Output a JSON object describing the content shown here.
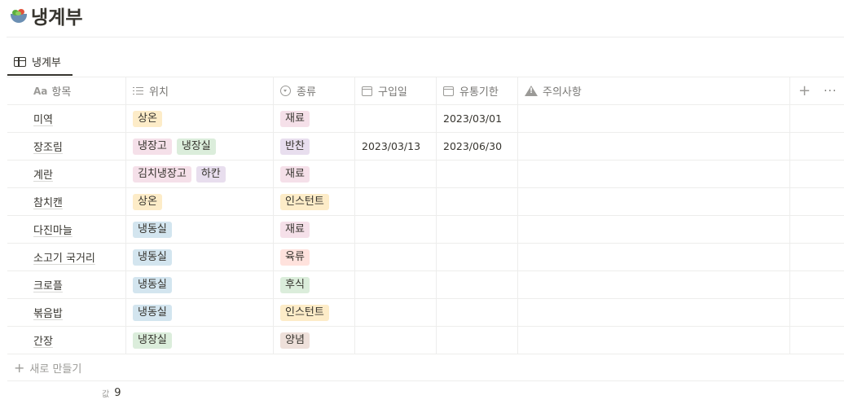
{
  "page": {
    "icon": "salad-bowl-icon",
    "title": "냉계부"
  },
  "view_tab": {
    "icon": "table-icon",
    "label": "냉계부"
  },
  "columns": [
    {
      "icon": "text-aa-icon",
      "icon_text": "Aa",
      "label": "항목"
    },
    {
      "icon": "list-icon",
      "label": "위치"
    },
    {
      "icon": "select-icon",
      "label": "종류"
    },
    {
      "icon": "calendar-icon",
      "label": "구입일"
    },
    {
      "icon": "calendar-icon",
      "label": "유통기한"
    },
    {
      "icon": "warning-icon",
      "label": "주의사항"
    }
  ],
  "header_actions": {
    "add": "+",
    "more": "···"
  },
  "rows": [
    {
      "name": "미역",
      "location": [
        {
          "text": "상온",
          "color": "yellow"
        }
      ],
      "type": [
        {
          "text": "재료",
          "color": "pink"
        }
      ],
      "purchase": "",
      "expiry": "2023/03/01",
      "note": ""
    },
    {
      "name": "장조림",
      "location": [
        {
          "text": "냉장고",
          "color": "pink"
        },
        {
          "text": "냉장실",
          "color": "green"
        }
      ],
      "type": [
        {
          "text": "반찬",
          "color": "purple"
        }
      ],
      "purchase": "2023/03/13",
      "expiry": "2023/06/30",
      "note": ""
    },
    {
      "name": "계란",
      "location": [
        {
          "text": "김치냉장고",
          "color": "pink"
        },
        {
          "text": "하칸",
          "color": "purple"
        }
      ],
      "type": [
        {
          "text": "재료",
          "color": "pink"
        }
      ],
      "purchase": "",
      "expiry": "",
      "note": ""
    },
    {
      "name": "참치캔",
      "location": [
        {
          "text": "상온",
          "color": "yellow"
        }
      ],
      "type": [
        {
          "text": "인스턴트",
          "color": "yellow"
        }
      ],
      "purchase": "",
      "expiry": "",
      "note": ""
    },
    {
      "name": "다진마늘",
      "location": [
        {
          "text": "냉동실",
          "color": "blue"
        }
      ],
      "type": [
        {
          "text": "재료",
          "color": "pink"
        }
      ],
      "purchase": "",
      "expiry": "",
      "note": ""
    },
    {
      "name": "소고기 국거리",
      "location": [
        {
          "text": "냉동실",
          "color": "blue"
        }
      ],
      "type": [
        {
          "text": "육류",
          "color": "red"
        }
      ],
      "purchase": "",
      "expiry": "",
      "note": ""
    },
    {
      "name": "크로플",
      "location": [
        {
          "text": "냉동실",
          "color": "blue"
        }
      ],
      "type": [
        {
          "text": "후식",
          "color": "green"
        }
      ],
      "purchase": "",
      "expiry": "",
      "note": ""
    },
    {
      "name": "볶음밥",
      "location": [
        {
          "text": "냉동실",
          "color": "blue"
        }
      ],
      "type": [
        {
          "text": "인스턴트",
          "color": "yellow"
        }
      ],
      "purchase": "",
      "expiry": "",
      "note": ""
    },
    {
      "name": "간장",
      "location": [
        {
          "text": "냉장실",
          "color": "green"
        }
      ],
      "type": [
        {
          "text": "양념",
          "color": "brown"
        }
      ],
      "purchase": "",
      "expiry": "",
      "note": ""
    }
  ],
  "new_row": {
    "icon": "plus-icon",
    "label": "새로 만들기"
  },
  "footer": {
    "count_label": "값",
    "count_value": "9"
  }
}
